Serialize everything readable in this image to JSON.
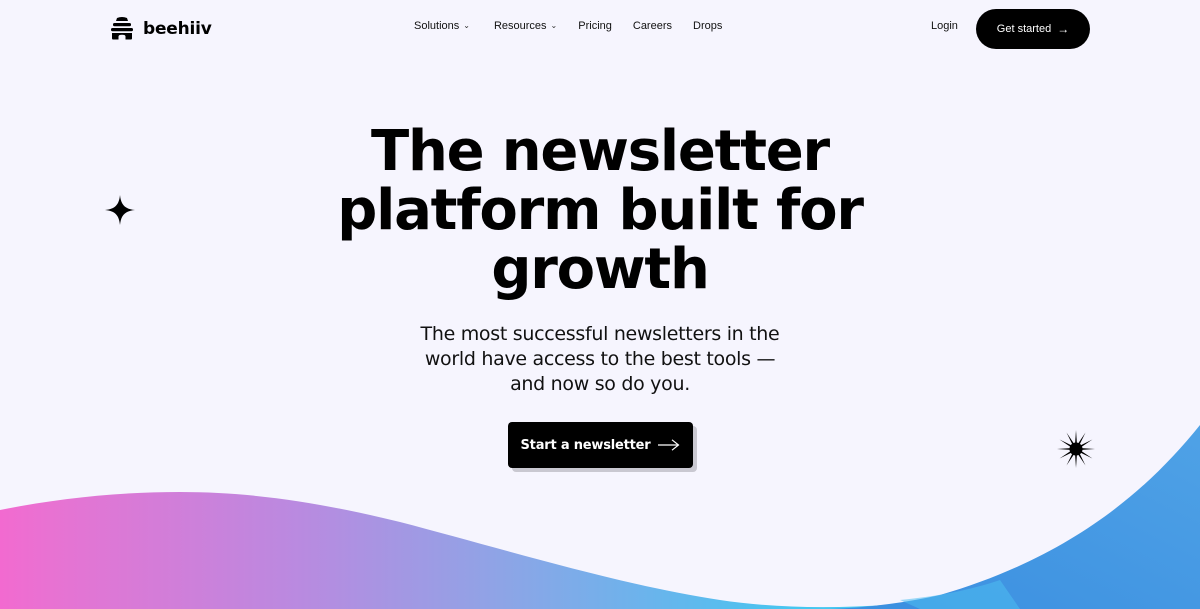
{
  "brand": {
    "name": "beehiiv",
    "logo_icon": "beehive-icon"
  },
  "nav": {
    "items": [
      {
        "label": "Solutions",
        "has_dropdown": true,
        "icon": "chevron-down-icon"
      },
      {
        "label": "Resources",
        "has_dropdown": true,
        "icon": "chevron-down-icon"
      },
      {
        "label": "Pricing",
        "has_dropdown": false
      },
      {
        "label": "Careers",
        "has_dropdown": false
      },
      {
        "label": "Drops",
        "has_dropdown": false
      }
    ],
    "chevron_glyph": "⌄",
    "login_label": "Login",
    "get_started_label": "Get started",
    "arrow_glyph": "→"
  },
  "hero": {
    "headline_lines": [
      "The newsletter",
      "platform built for",
      "growth"
    ],
    "subhead_lines": [
      "The most successful newsletters in the",
      "world have access to the best tools —",
      "and now so do you."
    ],
    "cta_label": "Start a newsletter",
    "cta_icon": "arrow-right-icon"
  },
  "decorations": {
    "left_icon": "four-point-sparkle-icon",
    "right_icon": "starburst-icon"
  },
  "colors": {
    "background": "#f6f5fe",
    "text": "#000000",
    "button_bg": "#000000",
    "button_text": "#ffffff",
    "wave_pink": "#f26ad0",
    "wave_purple": "#b98ae0",
    "wave_sky": "#42c8f0",
    "wave_blue": "#3d8fe0"
  }
}
